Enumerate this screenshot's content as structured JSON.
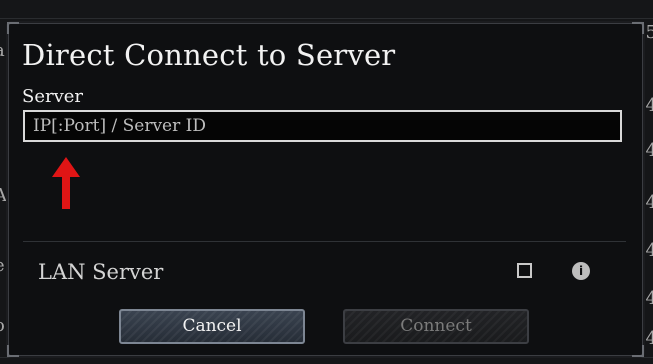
{
  "background": {
    "left_chars": [
      "a",
      "A",
      "e",
      "o"
    ],
    "right_chars": [
      "5",
      "4",
      "4",
      "4",
      "4",
      "4",
      "4"
    ]
  },
  "dialog": {
    "title": "Direct Connect to Server",
    "server_label": "Server",
    "server_placeholder": "IP[:Port] / Server ID",
    "server_value": "",
    "lan_label": "LAN Server",
    "lan_checked": false,
    "info_glyph": "i",
    "cancel_label": "Cancel",
    "connect_label": "Connect"
  },
  "annotation": {
    "arrow_color": "#e01515"
  },
  "colors": {
    "dialog_bg": "#0e0f11",
    "input_border": "#d9d9d9",
    "cancel_border": "#7d8693"
  }
}
